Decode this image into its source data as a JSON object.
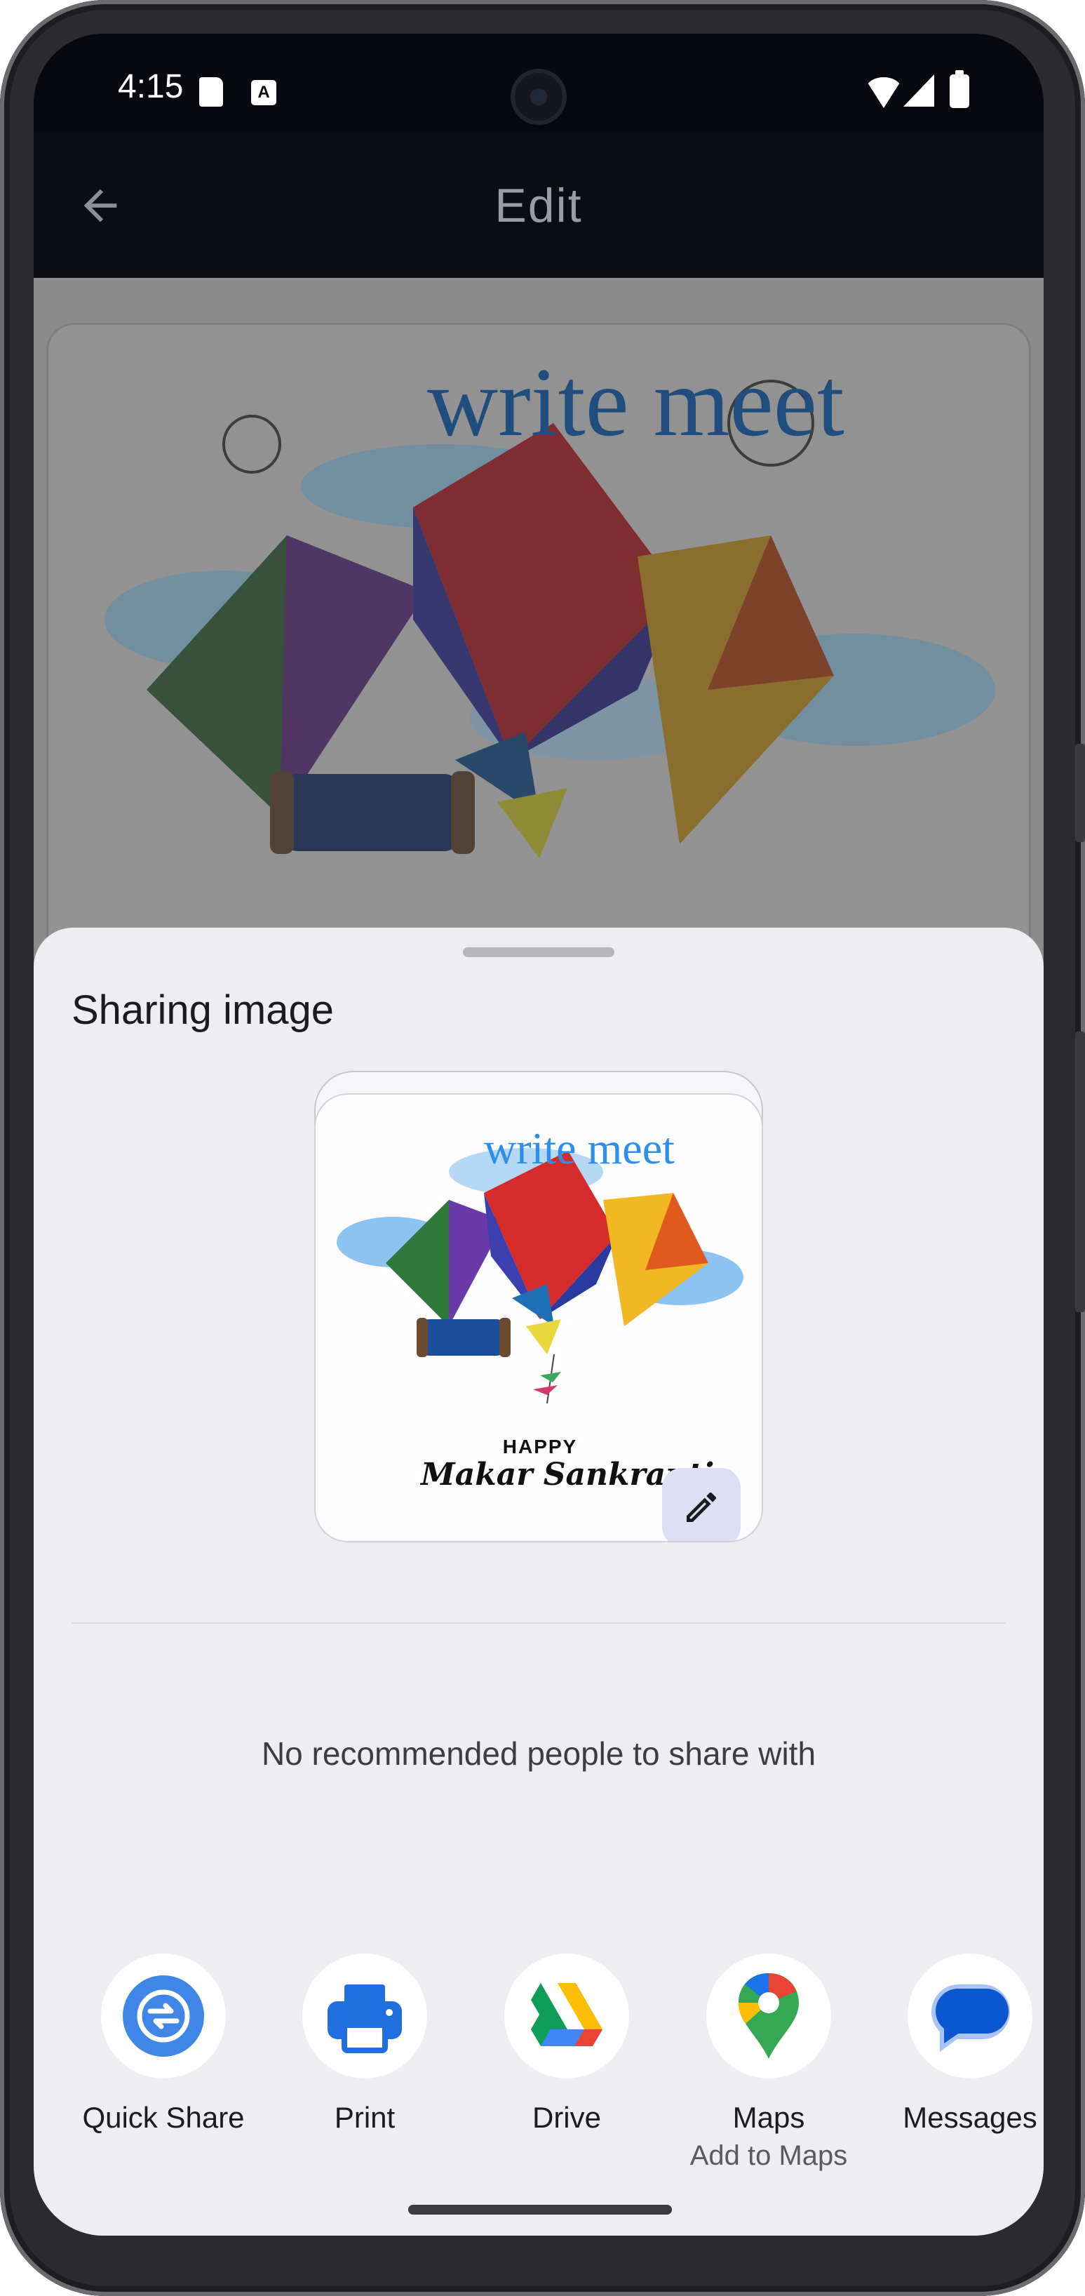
{
  "status_bar": {
    "time": "4:15",
    "icons": [
      "sd-card-icon",
      "a-notification-icon",
      "wifi-icon",
      "signal-icon",
      "battery-icon"
    ]
  },
  "app_bar": {
    "title": "Edit",
    "back_icon": "arrow-back-icon"
  },
  "background_card": {
    "text": "write meet"
  },
  "share_sheet": {
    "title": "Sharing image",
    "preview": {
      "title": "write meet",
      "happy": "HAPPY",
      "greeting": "Makar Sankranti",
      "edit_icon": "pencil-icon"
    },
    "empty_people_text": "No recommended people to share with",
    "targets": [
      {
        "label": "Quick Share",
        "sublabel": "",
        "icon": "quick-share-icon"
      },
      {
        "label": "Print",
        "sublabel": "",
        "icon": "printer-icon"
      },
      {
        "label": "Drive",
        "sublabel": "",
        "icon": "drive-icon"
      },
      {
        "label": "Maps",
        "sublabel": "Add to Maps",
        "icon": "maps-pin-icon"
      },
      {
        "label": "Messages",
        "sublabel": "",
        "icon": "messages-icon"
      }
    ]
  },
  "colors": {
    "sheet_background": "#eeedf1",
    "quick_share_blue": "#3f86e6",
    "edit_button_bg": "#dcdff6",
    "app_bar_bg": "#0b0d13"
  }
}
